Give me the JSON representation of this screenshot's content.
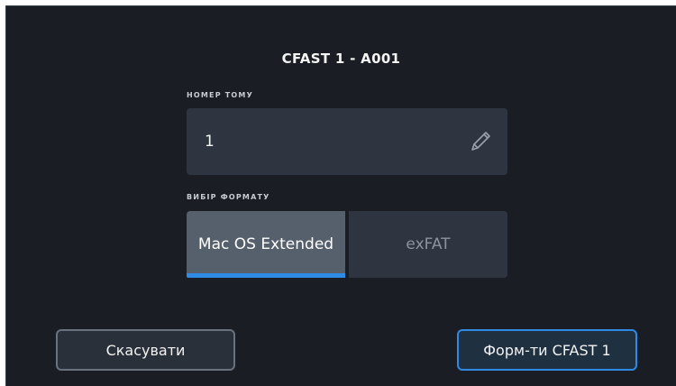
{
  "dialog": {
    "title": "CFAST 1 - A001",
    "volume_label": "НОМЕР ТОМУ",
    "volume_value": "1",
    "format_label": "ВИБІР ФОРМАТУ",
    "format_options": [
      {
        "label": "Mac OS Extended",
        "selected": true
      },
      {
        "label": "exFAT",
        "selected": false
      }
    ],
    "cancel_label": "Скасувати",
    "format_button_label": "Форм-ти CFAST 1"
  },
  "colors": {
    "background": "#1a1e24",
    "field": "#2e3540",
    "selected": "#56606d",
    "accent": "#2f8be6"
  },
  "icons": {
    "edit": "pencil-icon"
  }
}
